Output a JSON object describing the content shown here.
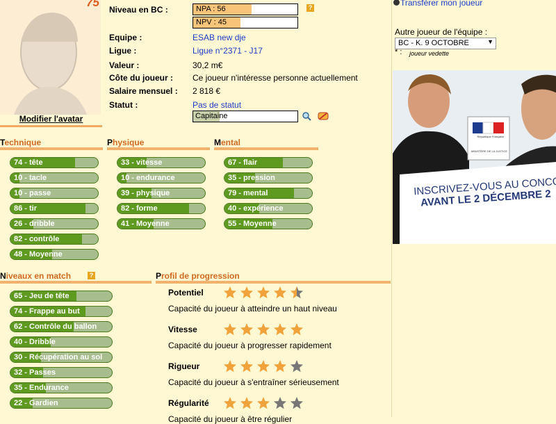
{
  "avatar": {
    "number": "75",
    "link_label": "Modifier l'avatar"
  },
  "info": {
    "niveau_label": "Niveau en BC :",
    "npa": {
      "text": "NPA : 56",
      "fill_fraction": 0.56
    },
    "npv": {
      "text": "NPV : 45",
      "fill_fraction": 0.45
    },
    "help": "?",
    "rows": [
      {
        "label": "Equipe :",
        "value": "ESAB new dje",
        "link": true
      },
      {
        "label": "Ligue :",
        "value": "Ligue n°2371 - J17",
        "link": true
      },
      {
        "label": "Valeur :",
        "value": "30,2 m€",
        "link": false
      },
      {
        "label": "Côte du joueur :",
        "value": "Ce joueur n'intéresse personne actuellement",
        "link": false
      },
      {
        "label": "Salaire mensuel :",
        "value": "2 818 €",
        "link": false
      },
      {
        "label": "Statut :",
        "value": "Pas de statut",
        "link": true
      }
    ],
    "captain_value": "Capitaine",
    "captain_fill_fraction": 0.25
  },
  "sections": {
    "technique": {
      "first": "T",
      "rest": "echnique"
    },
    "physique": {
      "first": "P",
      "rest": "hysique"
    },
    "mental": {
      "first": "M",
      "rest": "ental"
    },
    "niveaux": {
      "first": "N",
      "rest": "iveaux en match"
    },
    "profil": {
      "first": "P",
      "rest": "rofil de progression"
    }
  },
  "technique": [
    {
      "label": "74  -  tête",
      "value": 74
    },
    {
      "label": "10  -  tacle",
      "value": 10
    },
    {
      "label": "10  -  passe",
      "value": 10
    },
    {
      "label": "86  -  tir",
      "value": 86
    },
    {
      "label": "26  -  dribble",
      "value": 26
    },
    {
      "label": "82  -  contrôle",
      "value": 82
    },
    {
      "label": "48  -  Moyenne",
      "value": 48
    }
  ],
  "physique": [
    {
      "label": "33  -  vitesse",
      "value": 33
    },
    {
      "label": "10  -  endurance",
      "value": 10
    },
    {
      "label": "39  -  physique",
      "value": 39
    },
    {
      "label": "82  -  forme",
      "value": 82
    },
    {
      "label": "41  -  Moyenne",
      "value": 41
    }
  ],
  "mental": [
    {
      "label": "67  -  flair",
      "value": 67
    },
    {
      "label": "35  -  pression",
      "value": 35
    },
    {
      "label": "79  -  mental",
      "value": 79
    },
    {
      "label": "40  -  expérience",
      "value": 40
    },
    {
      "label": "55  -  Moyenne",
      "value": 55
    }
  ],
  "niveaux": [
    {
      "label": "65  -  Jeu de tête",
      "value": 65
    },
    {
      "label": "74  -  Frappe au but",
      "value": 74
    },
    {
      "label": "62  -  Contrôle du ballon",
      "value": 62
    },
    {
      "label": "40  -  Dribble",
      "value": 40
    },
    {
      "label": "30  -  Récupération au sol",
      "value": 30
    },
    {
      "label": "32  -  Passes",
      "value": 32
    },
    {
      "label": "35  -  Endurance",
      "value": 35
    },
    {
      "label": "22  -  Gardien",
      "value": 22
    }
  ],
  "progression": [
    {
      "label": "Potentiel",
      "stars": 4.5,
      "desc": "Capacité du joueur à atteindre un haut niveau"
    },
    {
      "label": "Vitesse",
      "stars": 5,
      "desc": "Capacité du joueur à progresser rapidement"
    },
    {
      "label": "Rigueur",
      "stars": 4,
      "desc": "Capacité du joueur à s'entraîner sérieusement"
    },
    {
      "label": "Régularité",
      "stars": 3,
      "desc": "Capacité du joueur à être régulier"
    }
  ],
  "right": {
    "transfer_link": "Transférer mon joueur",
    "other_label": "Autre joueur de l'équipe :",
    "select_value": "BC - K. 9 OCTOBRE",
    "legend_star": "* :",
    "legend_text": "joueur vedette"
  },
  "ad": {
    "line1": "INSCRIVEZ-VOUS AU CONCO",
    "line2": "AVANT LE 2 DÉCEMBRE 2",
    "seal_top": "République Française",
    "seal_bottom": "MINISTÈRE DE LA JUSTICE"
  },
  "colors": {
    "bg": "#fff8d2",
    "pill_fill": "#5e9a1f",
    "pill_bg": "#a7bd8e",
    "star_on": "#f2a23a",
    "star_off": "#777777",
    "accent": "#d2691e"
  }
}
